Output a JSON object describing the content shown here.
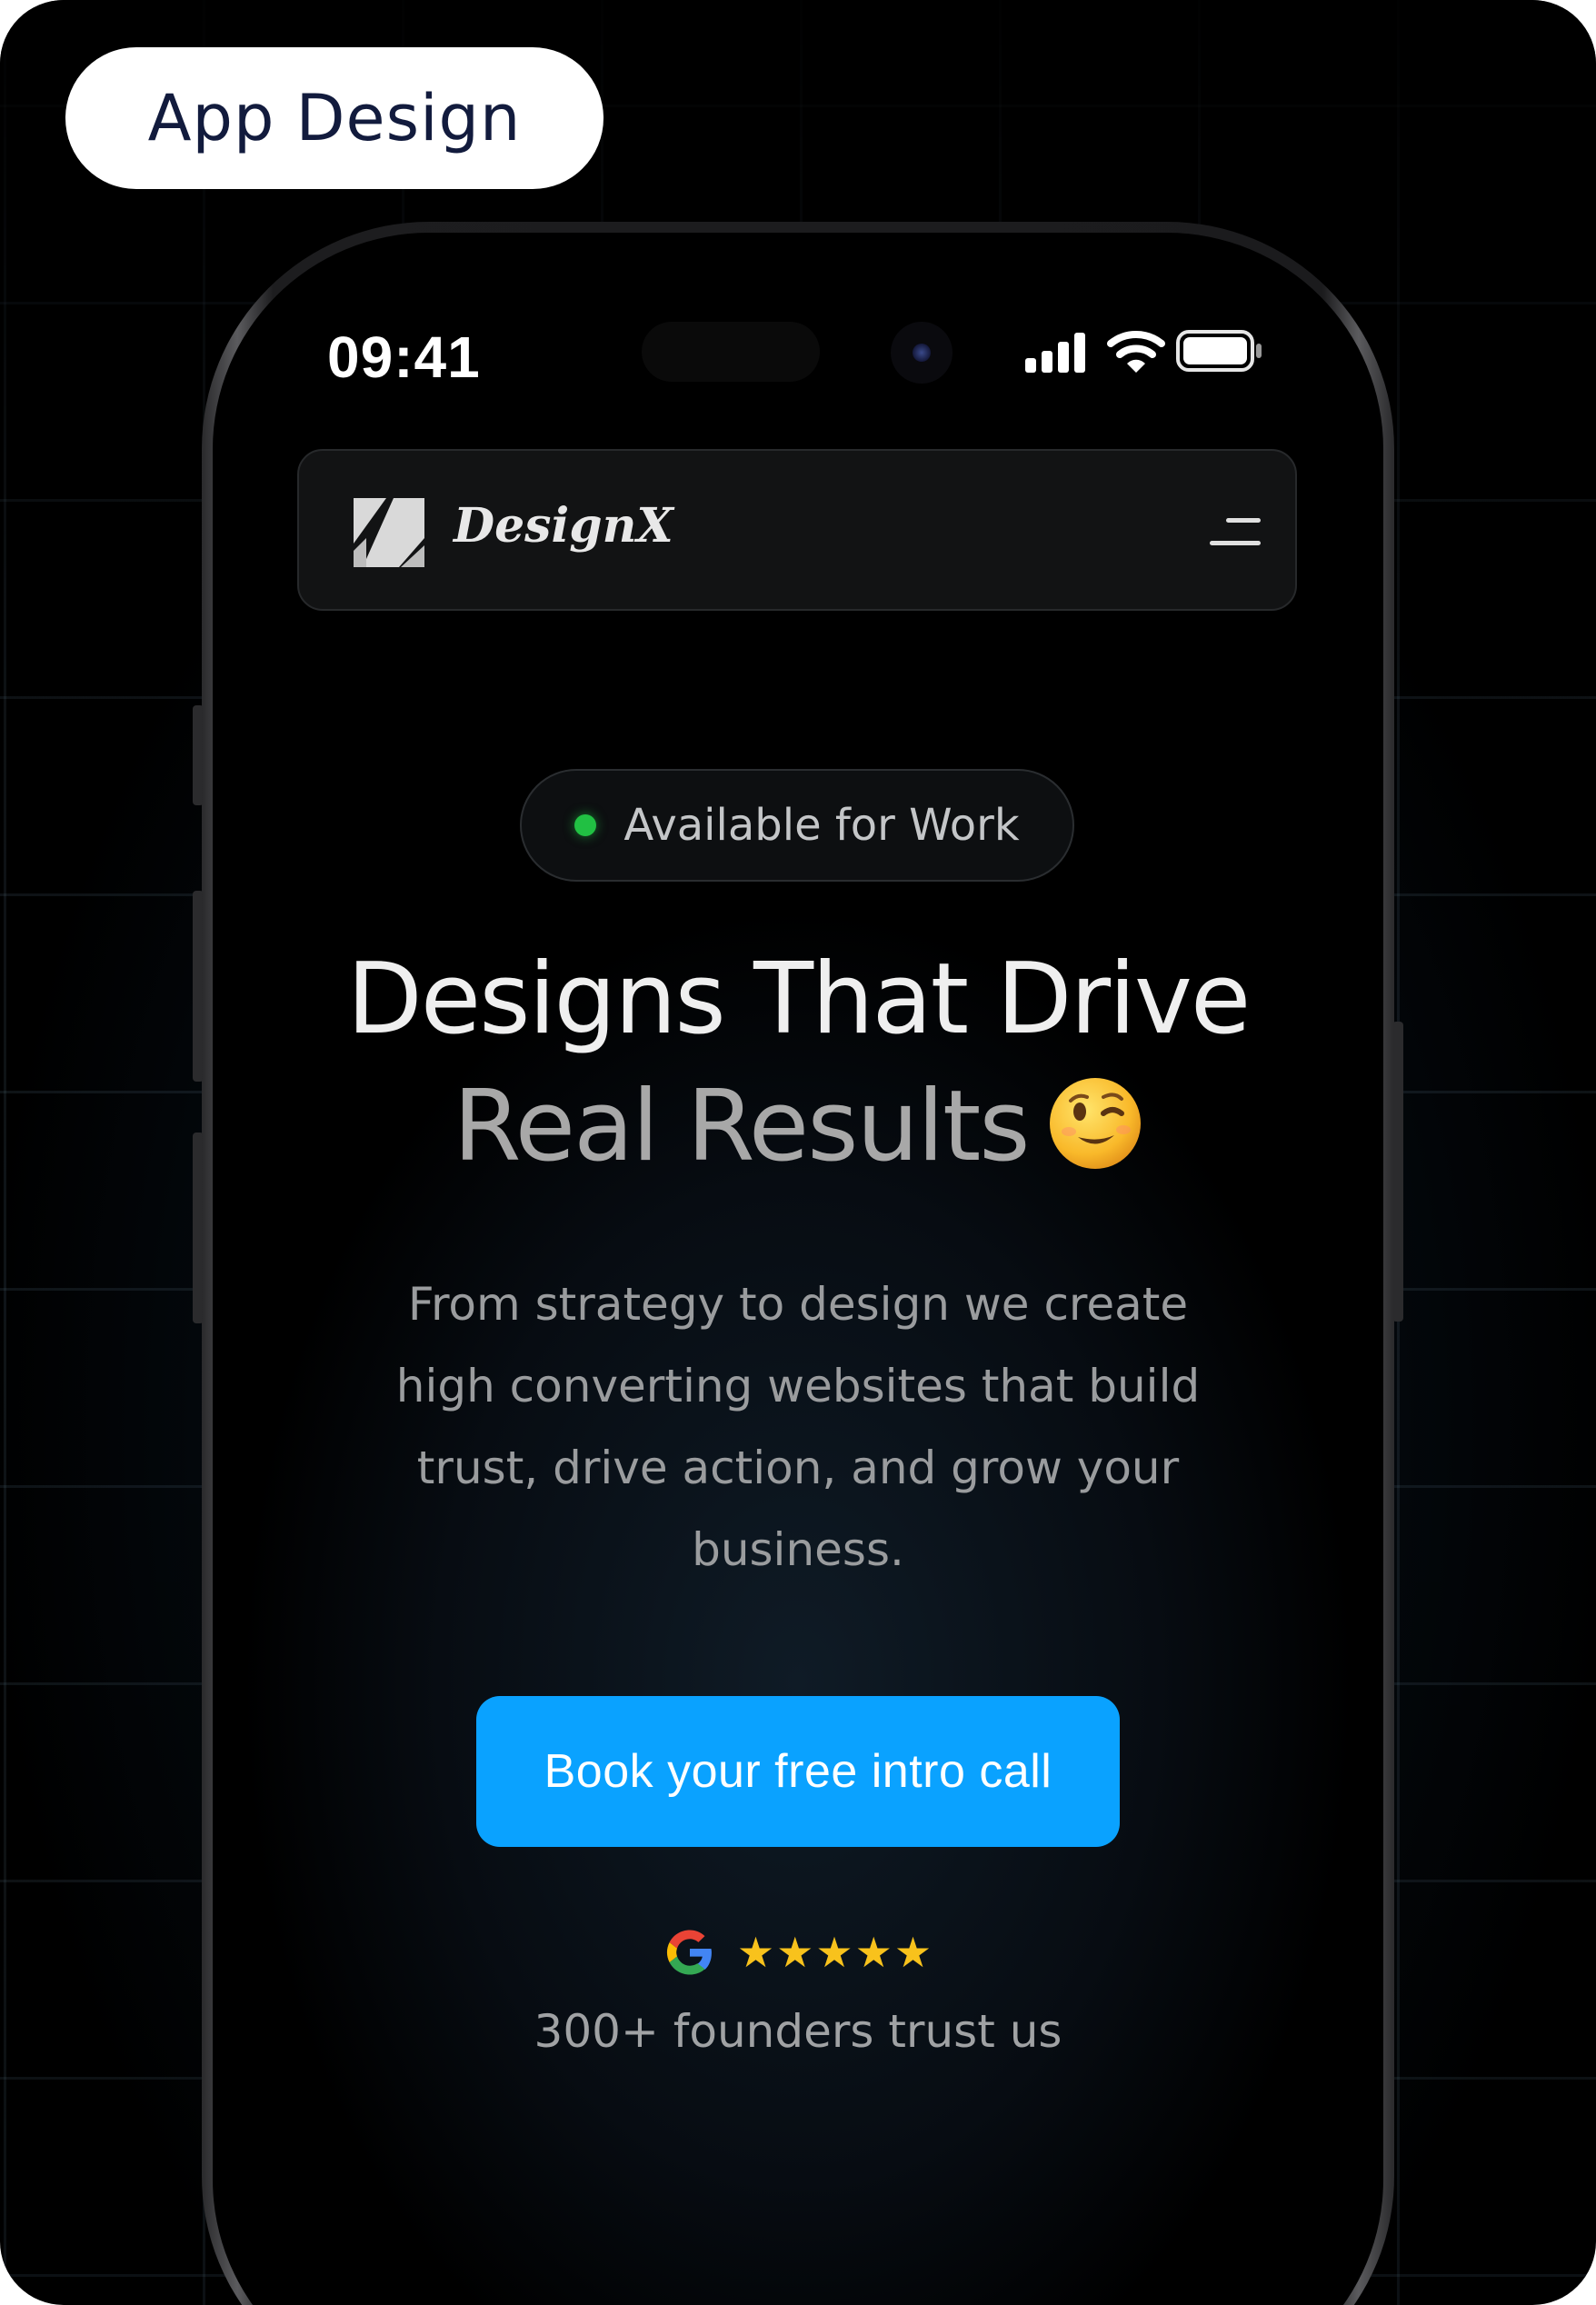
{
  "tag": {
    "label": "App Design"
  },
  "status_bar": {
    "time": "09:41",
    "icons": [
      "cellular-signal-icon",
      "wifi-icon",
      "battery-icon"
    ]
  },
  "navbar": {
    "brand": "DesignX",
    "menu_icon": "hamburger-menu-icon"
  },
  "hero": {
    "badge": "Available for Work",
    "headline_line1": "Designs That Drive",
    "headline_line2": "Real Results",
    "headline_emoji": "winking-face-emoji",
    "description": "From strategy to design we create high converting websites that build trust, drive action, and grow your business.",
    "cta_label": "Book your free intro call",
    "rating_source_icon": "google-g-icon",
    "stars": 5,
    "trust_text": "300+ founders trust us"
  },
  "colors": {
    "accent": "#0aa2ff",
    "status_dot": "#21c043",
    "star": "#f8c21c",
    "tag_text": "#121b3d"
  }
}
